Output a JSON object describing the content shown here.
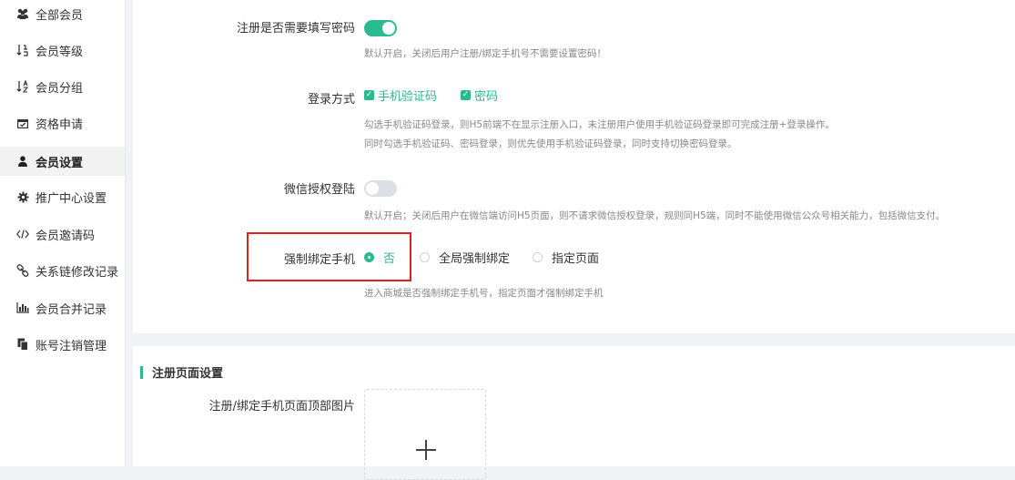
{
  "sidebar": {
    "items": [
      {
        "label": "全部会员",
        "icon": "users-icon"
      },
      {
        "label": "会员等级",
        "icon": "sort-numeric-icon"
      },
      {
        "label": "会员分组",
        "icon": "sort-alpha-icon"
      },
      {
        "label": "资格申请",
        "icon": "calendar-check-icon"
      },
      {
        "label": "会员设置",
        "icon": "user-icon",
        "active": true
      },
      {
        "label": "推广中心设置",
        "icon": "gear-icon"
      },
      {
        "label": "会员邀请码",
        "icon": "code-icon"
      },
      {
        "label": "关系链修改记录",
        "icon": "link-icon"
      },
      {
        "label": "会员合并记录",
        "icon": "bar-chart-icon"
      },
      {
        "label": "账号注销管理",
        "icon": "copy-icon"
      }
    ]
  },
  "settings": {
    "password_required": {
      "label": "注册是否需要填写密码",
      "enabled": true,
      "hint": "默认开启，关闭后用户注册/绑定手机号不需要设置密码！"
    },
    "login_method": {
      "label": "登录方式",
      "options": [
        {
          "label": "手机验证码",
          "checked": true
        },
        {
          "label": "密码",
          "checked": true
        }
      ],
      "hint_1": "勾选手机验证码登录，则H5前端不在显示注册入口，未注册用户使用手机验证码登录即可完成注册+登录操作。",
      "hint_2": "同时勾选手机验证码、密码登录，则优先使用手机验证码登录，同时支持切换密码登录。"
    },
    "wechat_auth": {
      "label": "微信授权登陆",
      "enabled": false,
      "hint": "默认开启；关闭后用户在微信端访问H5页面，则不请求微信授权登录，规则同H5端，同时不能使用微信公众号相关能力，包括微信支付。"
    },
    "force_bind_phone": {
      "label": "强制绑定手机",
      "options": [
        {
          "label": "否",
          "selected": true
        },
        {
          "label": "全局强制绑定",
          "selected": false
        },
        {
          "label": "指定页面",
          "selected": false
        }
      ],
      "hint": "进入商城是否强制绑定手机号，指定页面才强制绑定手机"
    }
  },
  "register_page": {
    "section_title": "注册页面设置",
    "header_image_label": "注册/绑定手机页面顶部图片"
  },
  "colors": {
    "accent": "#2bb990",
    "highlight_box": "#e02020"
  }
}
